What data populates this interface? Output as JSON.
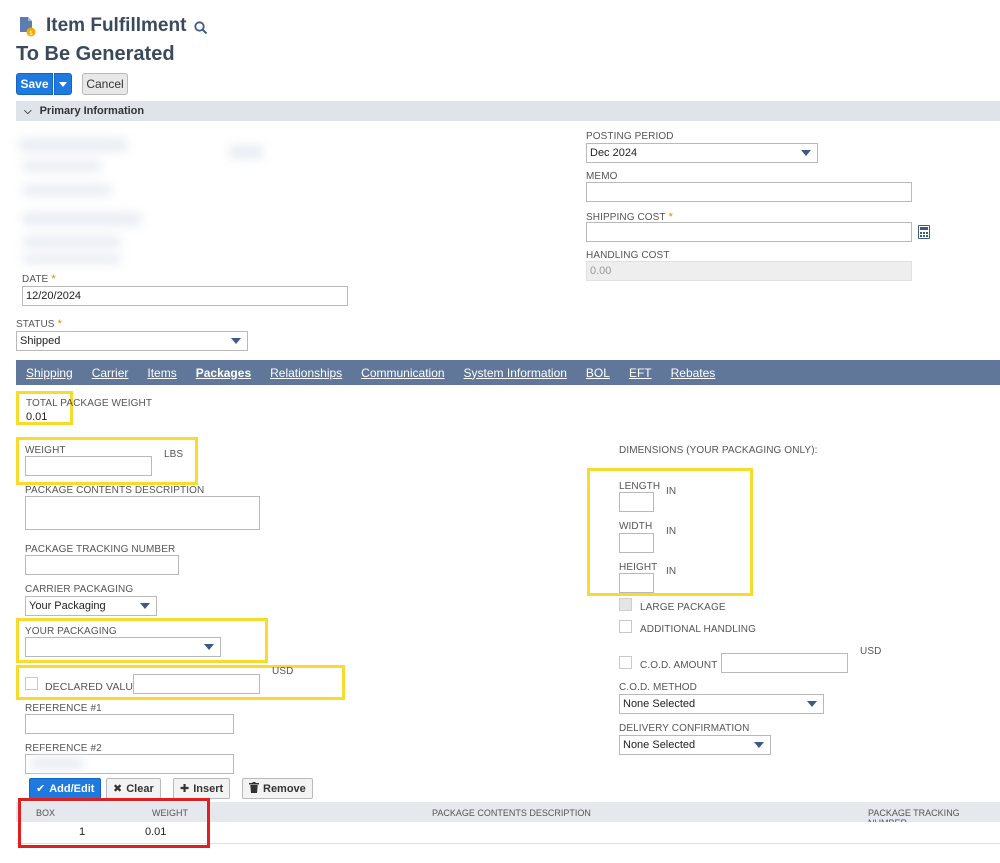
{
  "header": {
    "title": "Item Fulfillment",
    "subtitle": "To Be Generated",
    "save_label": "Save",
    "cancel_label": "Cancel"
  },
  "primary": {
    "section_label": "Primary Information",
    "date_label": "DATE",
    "date_value": "12/20/2024",
    "status_label": "STATUS",
    "status_value": "Shipped",
    "posting_period_label": "POSTING PERIOD",
    "posting_period_value": "Dec 2024",
    "memo_label": "MEMO",
    "memo_value": "",
    "shipping_cost_label": "SHIPPING COST",
    "shipping_cost_value": "",
    "handling_cost_label": "HANDLING COST",
    "handling_cost_placeholder": "0.00",
    "required_mark": "*"
  },
  "tabs": [
    "Shipping",
    "Carrier",
    "Items",
    "Packages",
    "Relationships",
    "Communication",
    "System Information",
    "BOL",
    "EFT",
    "Rebates"
  ],
  "active_tab": "Packages",
  "packages": {
    "total_weight_label": "TOTAL PACKAGE WEIGHT",
    "total_weight_value": "0.01",
    "weight_label": "WEIGHT",
    "weight_unit": "LBS",
    "contents_label": "PACKAGE CONTENTS DESCRIPTION",
    "tracking_label": "PACKAGE TRACKING NUMBER",
    "carrier_packaging_label": "CARRIER PACKAGING",
    "carrier_packaging_value": "Your Packaging",
    "your_packaging_label": "YOUR PACKAGING",
    "your_packaging_value": "",
    "declared_value_label": "DECLARED VALUE",
    "declared_value_currency": "USD",
    "reference1_label": "REFERENCE #1",
    "reference2_label": "REFERENCE #2",
    "dimensions_label": "DIMENSIONS (YOUR PACKAGING ONLY):",
    "length_label": "LENGTH",
    "width_label": "WIDTH",
    "height_label": "HEIGHT",
    "dim_unit": "IN",
    "large_package_label": "LARGE PACKAGE",
    "additional_handling_label": "ADDITIONAL HANDLING",
    "cod_amount_label": "C.O.D. AMOUNT",
    "cod_currency": "USD",
    "cod_method_label": "C.O.D. METHOD",
    "cod_method_value": "None Selected",
    "delivery_conf_label": "DELIVERY CONFIRMATION",
    "delivery_conf_value": "None Selected"
  },
  "grid": {
    "buttons": {
      "add_edit": "Add/Edit",
      "clear": "Clear",
      "insert": "Insert",
      "remove": "Remove"
    },
    "columns": [
      "BOX",
      "WEIGHT",
      "PACKAGE CONTENTS DESCRIPTION",
      "PACKAGE TRACKING NUMBER"
    ],
    "rows": [
      {
        "box": "1",
        "weight": "0.01",
        "contents": "",
        "tracking": ""
      }
    ]
  },
  "colors": {
    "accent": "#1f7ae0",
    "tab_bar": "#607799",
    "highlight_yellow": "#f7dc2e",
    "highlight_red": "#e02020"
  }
}
